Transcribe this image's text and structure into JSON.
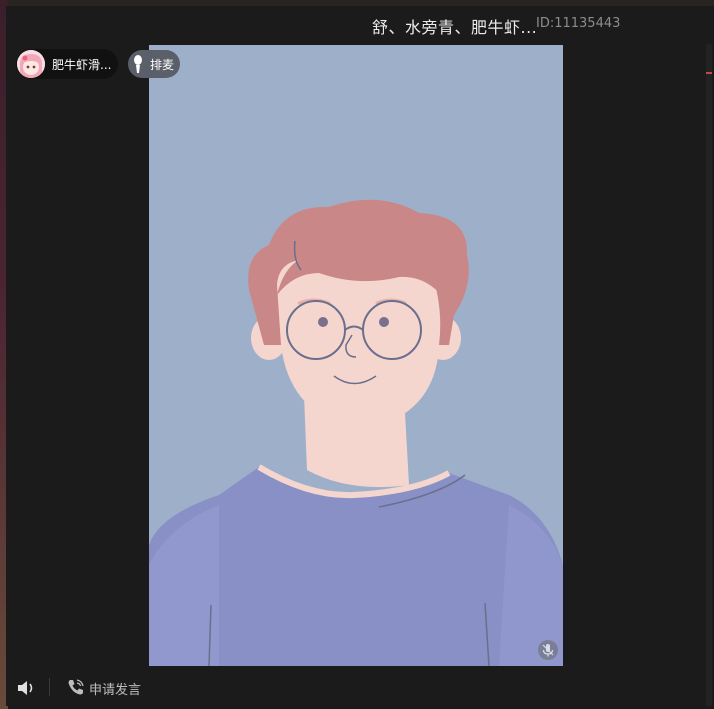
{
  "window": {
    "title": "舒、水旁青、肥牛虾...",
    "id_text": "ID:11135443"
  },
  "host": {
    "name": "肥牛虾滑...",
    "queue_label": "排麦"
  },
  "footer": {
    "apply_label": "申请发言"
  },
  "colors": {
    "window_bg": "#1b1b1b",
    "video_bg": "#9eb0c9",
    "hair": "#c98787",
    "skin": "#f5d6cf",
    "shirt": "#8890c6",
    "accent_tick": "#c04a4a"
  },
  "icons": {
    "avatar": "anime-avatar",
    "queue": "microphone-icon",
    "video_mic": "mic-muted-icon",
    "speaker": "speaker-icon",
    "phone": "phone-icon"
  }
}
